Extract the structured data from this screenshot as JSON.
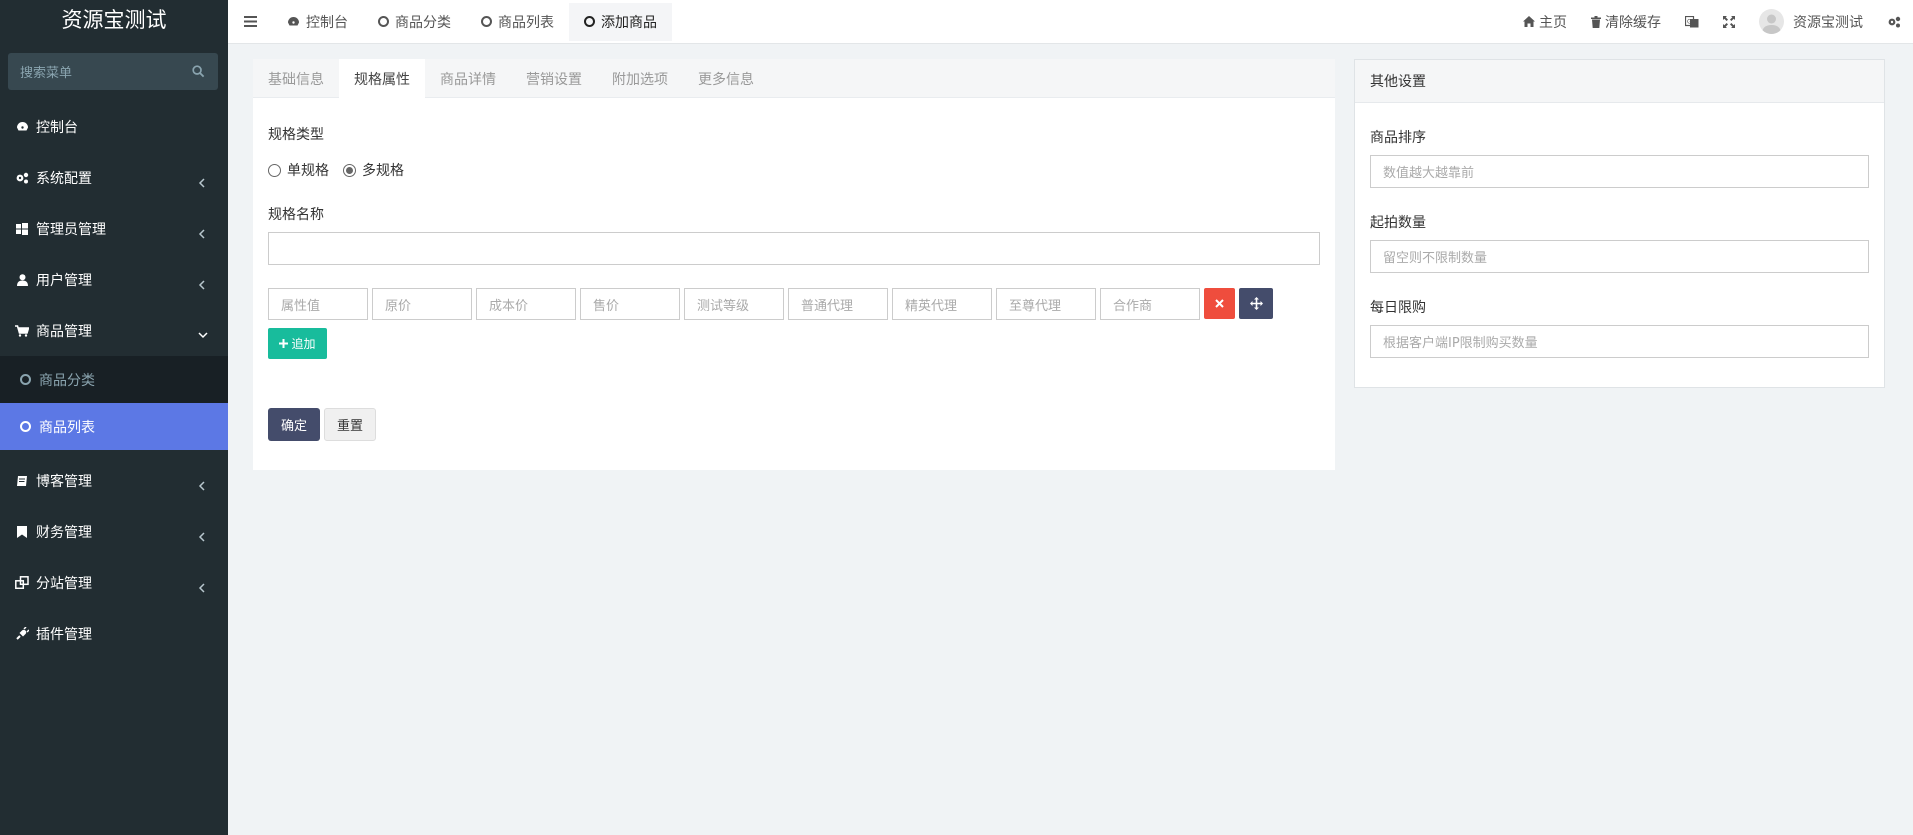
{
  "app": {
    "title": "资源宝测试"
  },
  "sidebar": {
    "search_placeholder": "搜索菜单",
    "items": [
      {
        "label": "控制台",
        "icon": "dashboard-icon",
        "has_caret": false
      },
      {
        "label": "系统配置",
        "icon": "cogs-icon",
        "has_caret": true
      },
      {
        "label": "管理员管理",
        "icon": "windows-icon",
        "has_caret": true
      },
      {
        "label": "用户管理",
        "icon": "user-icon",
        "has_caret": true
      },
      {
        "label": "商品管理",
        "icon": "cart-icon",
        "has_caret": true,
        "expanded": true
      },
      {
        "label": "博客管理",
        "icon": "book-icon",
        "has_caret": true
      },
      {
        "label": "财务管理",
        "icon": "bookmark-icon",
        "has_caret": true
      },
      {
        "label": "分站管理",
        "icon": "clone-icon",
        "has_caret": true
      },
      {
        "label": "插件管理",
        "icon": "plug-icon",
        "has_caret": false
      }
    ],
    "sub_items": [
      {
        "label": "商品分类",
        "active": false
      },
      {
        "label": "商品列表",
        "active": true
      }
    ]
  },
  "topbar": {
    "tabs": [
      {
        "label": "控制台",
        "icon": "dashboard-icon"
      },
      {
        "label": "商品分类",
        "icon": "circle-icon"
      },
      {
        "label": "商品列表",
        "icon": "circle-icon"
      },
      {
        "label": "添加商品",
        "icon": "circle-icon",
        "active": true
      }
    ],
    "right": {
      "home": "主页",
      "clear_cache": "清除缓存",
      "username": "资源宝测试"
    }
  },
  "form": {
    "tabs": [
      "基础信息",
      "规格属性",
      "商品详情",
      "营销设置",
      "附加选项",
      "更多信息"
    ],
    "active_tab": "规格属性",
    "spec_type_label": "规格类型",
    "spec_type_options": [
      {
        "label": "单规格",
        "checked": false
      },
      {
        "label": "多规格",
        "checked": true
      }
    ],
    "spec_name_label": "规格名称",
    "spec_name_value": "",
    "spec_fields": [
      "属性值",
      "原价",
      "成本价",
      "售价",
      "测试等级",
      "普通代理",
      "精英代理",
      "至尊代理",
      "合作商"
    ],
    "add_button": "追加",
    "submit_button": "确定",
    "reset_button": "重置"
  },
  "other_settings": {
    "title": "其他设置",
    "fields": [
      {
        "label": "商品排序",
        "placeholder": "数值越大越靠前"
      },
      {
        "label": "起拍数量",
        "placeholder": "留空则不限制数量"
      },
      {
        "label": "每日限购",
        "placeholder": "根据客户端IP限制购买数量"
      }
    ]
  },
  "colors": {
    "sidebar_bg": "#222d32",
    "active_blue": "#5c78e5",
    "success": "#18bc9c",
    "danger": "#ef4d3d",
    "primary_dark": "#444c6b"
  }
}
